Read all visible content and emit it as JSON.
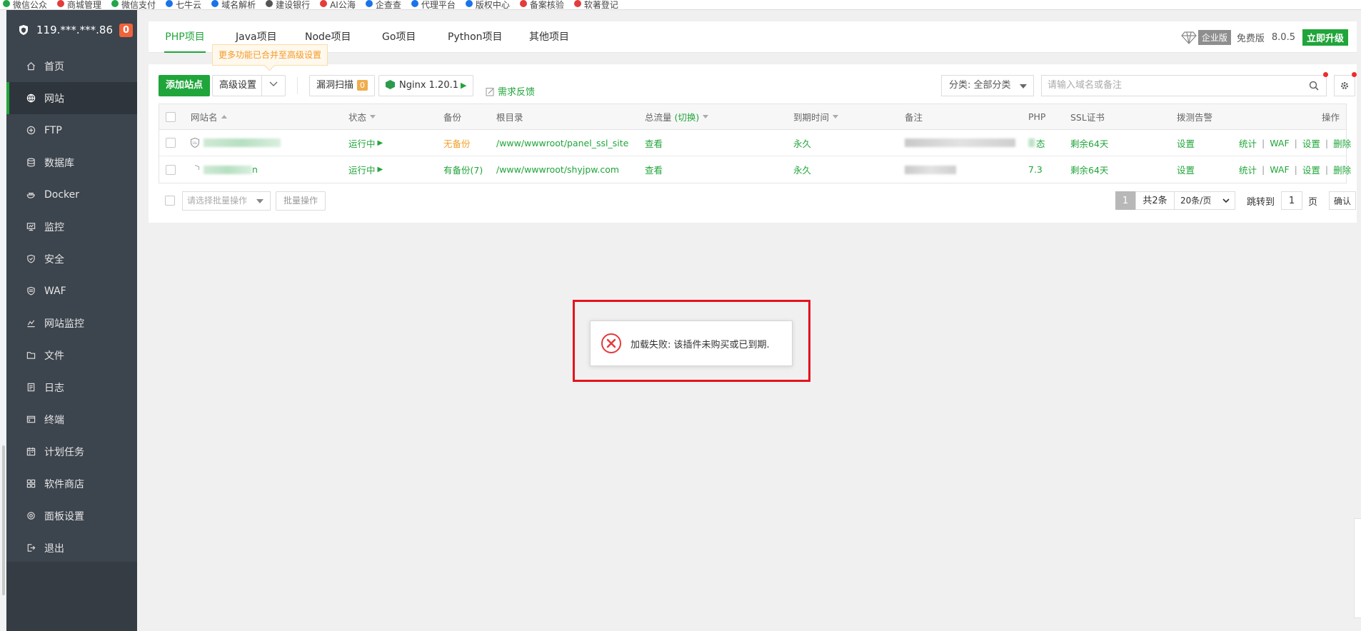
{
  "bookmarks": [
    "微信公众",
    "商城管理",
    "微信支付",
    "七牛云",
    "域名解析",
    "建设银行",
    "AI公海",
    "企查查",
    "代理平台",
    "版权中心",
    "备案核验",
    "软著登记"
  ],
  "sidebar": {
    "server_ip": "119.***.***.86",
    "badge_count": "0",
    "items": [
      {
        "label": "首页",
        "icon": "home-icon"
      },
      {
        "label": "网站",
        "icon": "globe-icon",
        "active": true
      },
      {
        "label": "FTP",
        "icon": "ftp-icon"
      },
      {
        "label": "数据库",
        "icon": "database-icon"
      },
      {
        "label": "Docker",
        "icon": "docker-icon"
      },
      {
        "label": "监控",
        "icon": "monitor-icon"
      },
      {
        "label": "安全",
        "icon": "shield-icon"
      },
      {
        "label": "WAF",
        "icon": "waf-icon"
      },
      {
        "label": "网站监控",
        "icon": "chart-icon"
      },
      {
        "label": "文件",
        "icon": "folder-icon"
      },
      {
        "label": "日志",
        "icon": "log-icon"
      },
      {
        "label": "终端",
        "icon": "terminal-icon"
      },
      {
        "label": "计划任务",
        "icon": "calendar-icon"
      },
      {
        "label": "软件商店",
        "icon": "grid-icon"
      },
      {
        "label": "面板设置",
        "icon": "gear-icon"
      },
      {
        "label": "退出",
        "icon": "logout-icon"
      }
    ]
  },
  "top_tabs": [
    "PHP项目",
    "Java项目",
    "Node项目",
    "Go项目",
    "Python项目",
    "其他项目"
  ],
  "header_right": {
    "edition": "企业版",
    "free": "免费版",
    "version": "8.0.5",
    "upgrade": "立即升级"
  },
  "tooltip": "更多功能已合并至高级设置",
  "toolbar": {
    "add_site": "添加站点",
    "advanced": "高级设置",
    "vuln_scan": "漏洞扫描",
    "vuln_count": "0",
    "nginx": "Nginx 1.20.1",
    "feedback": "需求反馈",
    "category": "分类: 全部分类",
    "search_placeholder": "请输入域名或备注"
  },
  "table": {
    "headers": [
      "网站名",
      "状态",
      "备份",
      "根目录",
      "总流量",
      "(切换)",
      "到期时间",
      "备注",
      "PHP",
      "SSL证书",
      "拨测告警",
      "操作"
    ],
    "rows": [
      {
        "name_suffix": "",
        "status": "运行中",
        "backup": "无备份",
        "root": "/www/wwwroot/panel_ssl_site",
        "traffic": "查看",
        "expire": "永久",
        "php": "态",
        "ssl": "剩余64天",
        "alarm": "设置"
      },
      {
        "name_suffix": "n",
        "status": "运行中",
        "backup": "有备份(7)",
        "root": "/www/wwwroot/shyjpw.com",
        "traffic": "查看",
        "expire": "永久",
        "php": "7.3",
        "ssl": "剩余64天",
        "alarm": "设置"
      }
    ],
    "ops": [
      "统计",
      "WAF",
      "设置",
      "删除"
    ]
  },
  "footer": {
    "batch_placeholder": "请选择批量操作",
    "batch_button": "批量操作",
    "page": "1",
    "total": "共2条",
    "per_page": "20条/页",
    "jump_to": "跳转到",
    "jump_value": "1",
    "page_unit": "页",
    "confirm": "确认"
  },
  "alert": {
    "message": "加载失败: 该插件未购买或已到期."
  },
  "colors": {
    "accent": "#20a53a",
    "sidebar": "#3c444d",
    "error": "#e4141e",
    "warning": "#f0a027"
  }
}
